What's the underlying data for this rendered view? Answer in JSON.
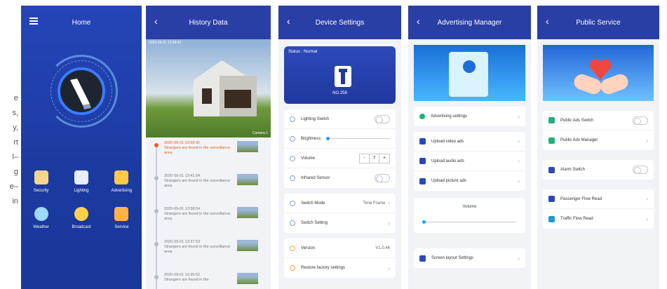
{
  "side_text": [
    "e",
    "s,",
    "y,",
    "rt",
    "l–",
    "g",
    "e–",
    "in"
  ],
  "home": {
    "title": "Home",
    "icons": [
      {
        "label": "Security",
        "icon": "security-guard-icon",
        "color": "#f4d58d"
      },
      {
        "label": "Lighting",
        "icon": "lighting-icon",
        "color": "#e8eefb"
      },
      {
        "label": "Advertising",
        "icon": "advertising-icon",
        "color": "#ffc94a"
      },
      {
        "label": "Weather",
        "icon": "weather-icon",
        "color": "#9fd8ff"
      },
      {
        "label": "Broadcast",
        "icon": "broadcast-icon",
        "color": "#ffd24a"
      },
      {
        "label": "Service",
        "icon": "service-icon",
        "color": "#ffb347"
      }
    ]
  },
  "history": {
    "title": "History Data",
    "photo_timestamp": "2020-09-01 12:58:42",
    "photo_caption": "Camera 1",
    "items": [
      {
        "time": "2020-09-01 13:58:42",
        "text": "Strangers are found in the surveillance area.",
        "active": true
      },
      {
        "time": "2020-09-01 13:41:54",
        "text": "Strangers are found in the surveillance area.",
        "active": false
      },
      {
        "time": "2020-09-01 13:38:54",
        "text": "Strangers are found in the surveillance area.",
        "active": false
      },
      {
        "time": "2020-09-01 13:37:53",
        "text": "Strangers are found in the surveillance area.",
        "active": false
      },
      {
        "time": "2020-09-01 13:35:52",
        "text": "Strangers are found in the",
        "active": false
      }
    ]
  },
  "device": {
    "title": "Device Settings",
    "status": "Status : Normal",
    "device_no": "NO.258",
    "rows1": {
      "lighting_switch": "Lighting Switch",
      "brightness": "Brightness",
      "volume": "Volume",
      "volume_value": "7",
      "infrared": "Infrared Sensor"
    },
    "switch_mode": "Switch Mode",
    "switch_mode_value": "Time Frame",
    "switch_setting": "Switch Setting",
    "version": "Version",
    "version_value": "V1.0.46",
    "restore": "Restore factory settings"
  },
  "adv": {
    "title": "Advertising Manager",
    "advertising_settings": "Advertising settings",
    "upload_video": "Upload video ads",
    "upload_audio": "Upload audio ads",
    "upload_picture": "Upload picture ads",
    "volume": "Volume",
    "screen_layout": "Screen layout Settings"
  },
  "public": {
    "title": "Public Service",
    "public_ads_switch": "Public Ads Switch",
    "public_ads_manager": "Public Ads Manager",
    "alarm_switch": "Alarm Switch",
    "passenger_flow": "Passenger Flow Read",
    "traffic_flow": "Traffic Flow Read"
  }
}
